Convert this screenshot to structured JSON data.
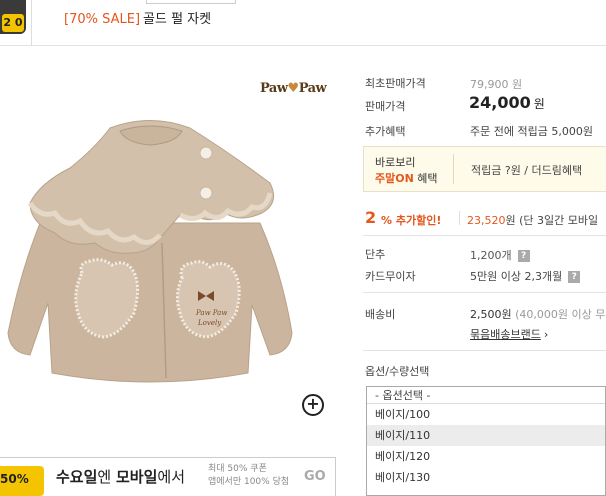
{
  "header": {
    "badge_value": "2 0",
    "title_tag": "[70% SALE]",
    "title_name": "골드 펄 자켓"
  },
  "product_image": {
    "brand_logo_left": "Paw",
    "brand_logo_mid": "♥",
    "brand_logo_right": "Paw",
    "zoom_icon": "zoom-in-icon",
    "zoom_glyph": "+"
  },
  "banner": {
    "badge_text": "50%",
    "main_prefix": "수요일",
    "main_mid": "엔 ",
    "main_bold": "모바일",
    "main_suffix": "에서",
    "sub_line1": "최대 50% 쿠폰",
    "sub_line2": "앱에서만 100% 당첨",
    "go_label": "GO"
  },
  "info": {
    "original_price_label": "최초판매가격",
    "original_price_value": "79,900 원",
    "sale_price_label": "판매가격",
    "sale_price_value": "24,000",
    "sale_price_unit": "원",
    "extra_benefit_label": "추가혜택",
    "extra_benefit_value": "주문 전에 적립금 5,000원",
    "benefit_box_line1": "바로보리",
    "benefit_box_line2_highlight": "주말ON",
    "benefit_box_line2_rest": " 혜택",
    "benefit_box_right": "적립금 ?원 / 더드림혜택",
    "discount_pct": "2",
    "discount_label": "% 추가할인!",
    "discount_detail_price": "23,520",
    "discount_detail_rest": "원 (단 3일간 모바일",
    "unit_label": "단추",
    "unit_value": "1,200개",
    "card_label": "카드무이자",
    "card_value": "5만원 이상 2,3개월",
    "shipping_label": "배송비",
    "shipping_value": "2,500원",
    "shipping_note": " (40,000원 이상 무",
    "bundle_link": "묶음배송브랜드",
    "bundle_arrow": "›",
    "help_glyph": "?"
  },
  "options": {
    "title": "옵션/수량선택",
    "items": [
      "- 옵션선택 -",
      "베이지/100",
      "베이지/110",
      "베이지/120",
      "베이지/130"
    ],
    "selected_index": 2
  }
}
